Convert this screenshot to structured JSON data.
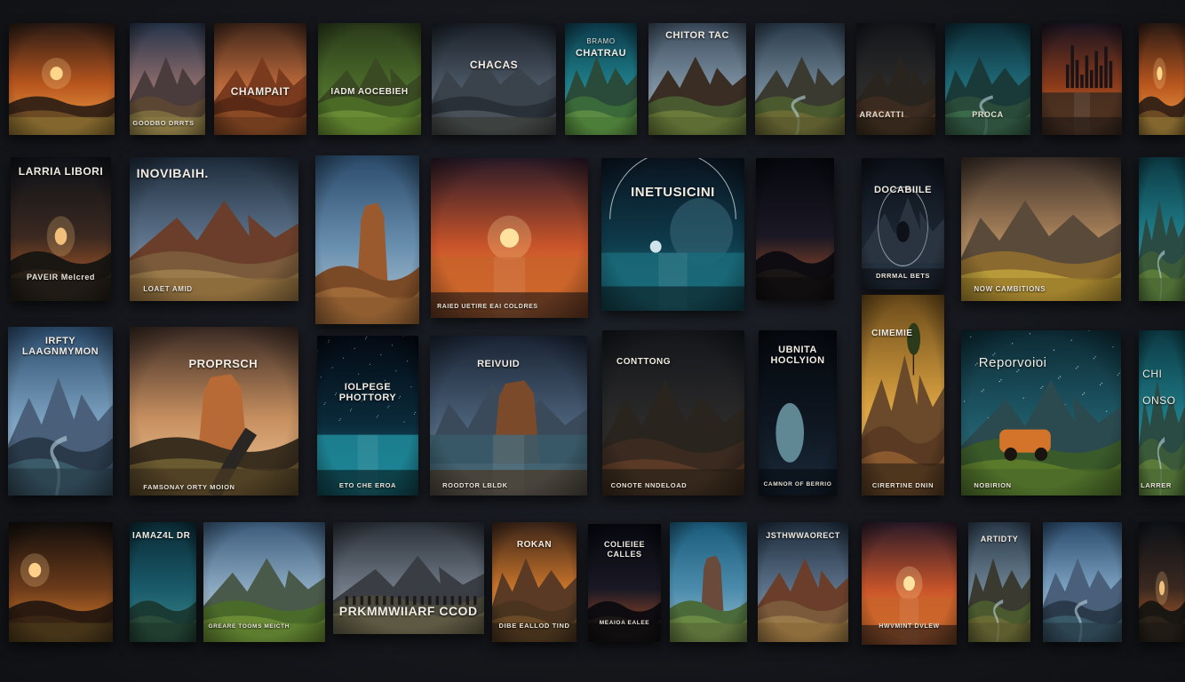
{
  "title": "",
  "posters": [
    {
      "id": "r1c1",
      "ttl": "",
      "sub": "",
      "cap": "",
      "art": "sunset-meadow"
    },
    {
      "id": "r1c2",
      "ttl": "",
      "sub": "",
      "cap": "GOODBO DRRTS",
      "art": "mountain-dawn"
    },
    {
      "id": "r1c3",
      "ttl": "CHAMPAIT",
      "sub": "",
      "cap": "",
      "art": "rust-canyon"
    },
    {
      "id": "r1c4",
      "ttl": "IADM AOCEBIEH",
      "sub": "",
      "cap": "",
      "art": "green-valley"
    },
    {
      "id": "r1c5",
      "ttl": "CHACAS",
      "sub": "",
      "cap": "",
      "art": "grey-mountains"
    },
    {
      "id": "r1c6",
      "ttl": "CHATRAU",
      "sub": "BRAMO",
      "cap": "",
      "art": "teal-hills"
    },
    {
      "id": "r1c7",
      "ttl": "CHITOR TAC",
      "sub": "",
      "cap": "",
      "art": "cliff-sky"
    },
    {
      "id": "r1c8",
      "ttl": "",
      "sub": "",
      "cap": "",
      "art": "river-valley"
    },
    {
      "id": "r1c9",
      "ttl": "",
      "sub": "",
      "cap": "ARACATTI",
      "art": "dark-cliff"
    },
    {
      "id": "r1c10",
      "ttl": "",
      "sub": "",
      "cap": "PROCA",
      "art": "teal-waterfall"
    },
    {
      "id": "r1c11",
      "ttl": "",
      "sub": "",
      "cap": "",
      "art": "city-sunset"
    },
    {
      "id": "r1c12",
      "ttl": "",
      "sub": "",
      "cap": "",
      "art": "sunset-meadow"
    },
    {
      "id": "r2c1",
      "ttl": "LARRIA LIBORI",
      "sub": "",
      "cap": "PAVEIR Melcred",
      "art": "dark-sunset"
    },
    {
      "id": "r2c2",
      "ttl": "INOVIBAIH.",
      "sub": "",
      "cap": "LOAET AMID",
      "art": "rocky-peaks"
    },
    {
      "id": "r2c3",
      "ttl": "",
      "sub": "",
      "cap": "",
      "art": "desert-rock"
    },
    {
      "id": "r2c4",
      "ttl": "",
      "sub": "",
      "cap": "RAIED UETIRE EAI COLDRES",
      "art": "orange-sunset"
    },
    {
      "id": "r2c5",
      "ttl": "INETUSICINI",
      "sub": "",
      "cap": "",
      "art": "planet-sea"
    },
    {
      "id": "r2c6",
      "ttl": "",
      "sub": "",
      "cap": "",
      "art": "night-horizon"
    },
    {
      "id": "r2c7",
      "ttl": "DOCABIILE",
      "sub": "",
      "cap": "DRRMAL BETS",
      "art": "moon-badge"
    },
    {
      "id": "r2c8",
      "ttl": "",
      "sub": "",
      "cap": "NOW CAMBITIONS",
      "art": "golden-valley"
    },
    {
      "id": "r2c9",
      "ttl": "",
      "sub": "",
      "cap": "",
      "art": "teal-river"
    },
    {
      "id": "r3c1",
      "ttl": "IRFTY LAAGNMYMON",
      "sub": "",
      "cap": "",
      "art": "blue-mountains"
    },
    {
      "id": "r3c2",
      "ttl": "PROPRSCH",
      "sub": "",
      "cap": "FAMSONAY ORTY MOION",
      "art": "road-canyon"
    },
    {
      "id": "r3c3",
      "ttl": "IOLPEGE PHOTTORY",
      "sub": "",
      "cap": "ETO CHE EROA",
      "art": "star-sea"
    },
    {
      "id": "r3c4",
      "ttl": "REIVUID",
      "sub": "",
      "cap": "ROODTOR LBLDK",
      "art": "rock-coast"
    },
    {
      "id": "r3c5",
      "ttl": "CONTTONG",
      "sub": "",
      "cap": "CONOTE NNDELOAD",
      "art": "dark-cliff"
    },
    {
      "id": "r3c6",
      "ttl": "UBNITA HOCLYION",
      "sub": "",
      "cap": "CAMNOR OF BERRIO",
      "art": "globe"
    },
    {
      "id": "r3c7",
      "ttl": "CIMEMIE",
      "sub": "",
      "cap": "CIRERTINE DNIN",
      "art": "yellow-tree"
    },
    {
      "id": "r3c8",
      "ttl": "Reporvoioi",
      "sub": "",
      "cap": "NOBIRION",
      "art": "car-lake"
    },
    {
      "id": "r3c9",
      "ttl": "CHI ONSO",
      "sub": "",
      "cap": "LARRER",
      "art": "teal-river"
    },
    {
      "id": "r4c1",
      "ttl": "",
      "sub": "",
      "cap": "",
      "art": "dark-sunset-sun"
    },
    {
      "id": "r4c2",
      "ttl": "IAMAZ4L DR",
      "sub": "",
      "cap": "",
      "art": "teal-plain"
    },
    {
      "id": "r4c3",
      "ttl": "",
      "sub": "",
      "cap": "GREARE TOOMS MEICTH",
      "art": "green-hills"
    },
    {
      "id": "r4c4",
      "ttl": "PRKMMWIIARF CCODOU",
      "sub": "",
      "cap": "",
      "art": "crowd-mountains"
    },
    {
      "id": "r4c5",
      "ttl": "ROKAN",
      "sub": "",
      "cap": "DIBE EALLOD TIND",
      "art": "sunset-plain"
    },
    {
      "id": "r4c6",
      "ttl": "COLIEIEE CALLES",
      "sub": "",
      "cap": "MEAIOA EALEE",
      "art": "night-horizon"
    },
    {
      "id": "r4c7",
      "ttl": "",
      "sub": "",
      "cap": "",
      "art": "teal-cliff"
    },
    {
      "id": "r4c8",
      "ttl": "JSTHWWAORECT",
      "sub": "",
      "cap": "",
      "art": "rocky-peaks"
    },
    {
      "id": "r4c9",
      "ttl": "",
      "sub": "",
      "cap": "HWVMINT DVLEW",
      "art": "orange-sunset"
    },
    {
      "id": "r4c10",
      "ttl": "ARTIDTY",
      "sub": "",
      "cap": "",
      "art": "river-valley"
    },
    {
      "id": "r4c11",
      "ttl": "",
      "sub": "",
      "cap": "",
      "art": "blue-mountains"
    },
    {
      "id": "r4c12",
      "ttl": "",
      "sub": "",
      "cap": "",
      "art": "dark-sunset"
    }
  ],
  "palette": {
    "sunset": "#e88a2a",
    "teal": "#1f7e8a",
    "night": "#0c1420",
    "earth": "#7a4a26",
    "grass": "#7c8a3a"
  }
}
